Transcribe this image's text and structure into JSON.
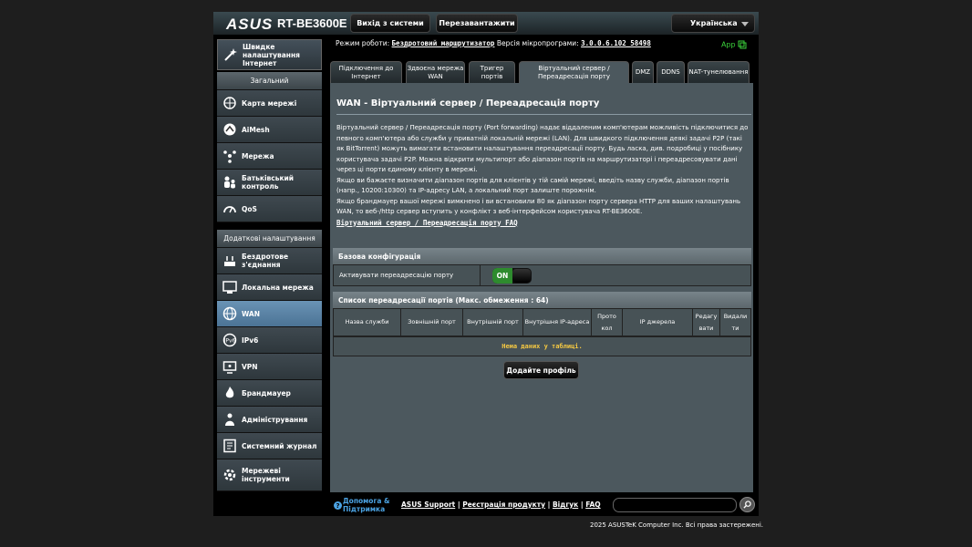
{
  "header": {
    "logo": "/ISUS",
    "model": "RT-BE3600E",
    "logout": "Вихід з системи",
    "reboot": "Перезавантажити",
    "language": "Українська"
  },
  "topbar": {
    "mode_label": "Режим роботи:",
    "mode_value": "Бездротовий маршрутизатор",
    "fw_label": "Версія мікропрограми:",
    "fw_value": "3.0.0.6.102_58498",
    "app": "App"
  },
  "sidebar": {
    "quick": "Швидке налаштування Інтернет",
    "general": "Загальний",
    "general_items": [
      "Карта мережі",
      "AiMesh",
      "Мережа",
      "Батьківський контроль",
      "QoS"
    ],
    "advanced": "Додаткові налаштування",
    "advanced_items": [
      "Бездротове з'єднання",
      "Локальна мережа",
      "WAN",
      "IPv6",
      "VPN",
      "Брандмауер",
      "Адміністрування",
      "Системний журнал",
      "Мережеві інструменти"
    ]
  },
  "tabs": [
    "Підключення до Інтернет",
    "Здвоєна мережа WAN",
    "Тригер портів",
    "Віртуальний сервер / Переадресація порту",
    "DMZ",
    "DDNS",
    "NAT-тунелювання"
  ],
  "panel": {
    "title": "WAN - Віртуальний сервер / Переадресація порту",
    "desc1": "Віртуальний сервер / Переадресація порту (Port forwarding) надає віддаленим комп'ютерам можливість підключитися до певного комп'ютера або служби у приватній локальній мережі (LAN). Для швидкого підключення деякі задачі P2P (такі як BitTorrent) можуть вимагати встановити налаштування переадресації порту. Будь ласка, див. подробиці у посібнику користувача задачі P2P. Можна відкрити мультипорт або діапазон портів на маршрутизаторі і переадресовувати дані через ці порти єдиному клієнту в мережі.",
    "desc2": "Якщо ви бажаєте визначити діапазон портів для клієнтів у тій самій мережі, введіть назву служби, діапазон портів (напр., 10200:10300) та IP-адресу LAN, а локальний порт залиште порожнім.",
    "desc3": "Якщо брандмауер вашої мережі вимкнено і ви встановили 80 як діапазон порту сервера HTTP для ваших налаштувань WAN, то веб-/http сервер вступить у конфлікт з веб-інтерфейсом користувача RT-BE3600E.",
    "faq": "Віртуальний сервер / Переадресація порту FAQ",
    "basic_title": "Базова конфігурація",
    "enable_label": "Активувати переадресацію порту",
    "toggle": "ON",
    "list_title": "Список переадресації портів (Макс. обмеження : 64)",
    "columns": [
      "Назва служби",
      "Зовнішній порт",
      "Внутрішній порт",
      "Внутрішня IP-адреса",
      "Протокол",
      "IP джерела",
      "Редагувати",
      "Видалити"
    ],
    "empty": "Нема даних у таблиці.",
    "add": "Додайте профіль"
  },
  "footer": {
    "help": "Допомога & Підтримка",
    "links": [
      "ASUS Support",
      "Реєстрація продукту",
      "Відгук",
      "FAQ"
    ],
    "copyright": "2025 ASUSTeK Computer Inc. Всі права застережені."
  }
}
